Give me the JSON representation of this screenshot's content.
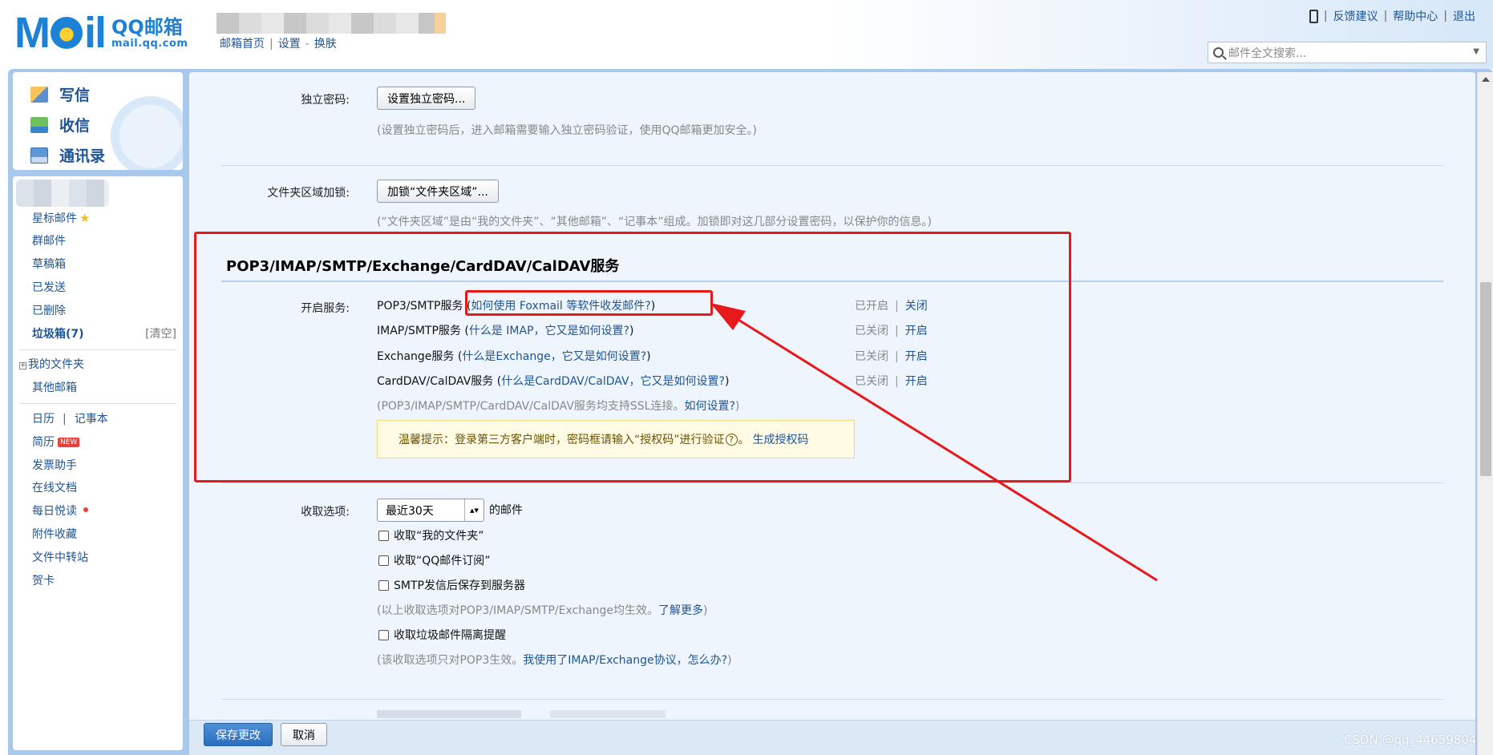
{
  "header": {
    "logo_text": "M  il",
    "brand_name": "QQ邮箱",
    "brand_domain": "mail.qq.com",
    "nav": [
      "邮箱首页",
      "设置",
      "换肤"
    ],
    "links": [
      "反馈建议",
      "帮助中心",
      "退出"
    ],
    "search_placeholder": "邮件全文搜索..."
  },
  "quick_actions": [
    "写信",
    "收信",
    "通讯录"
  ],
  "folders": {
    "starred": "星标邮件",
    "group": "群邮件",
    "drafts": "草稿箱",
    "sent": "已发送",
    "deleted": "已删除",
    "spam": "垃圾箱(7)",
    "spam_clear": "[清空]",
    "my_folders": "我的文件夹",
    "other_mailboxes": "其他邮箱",
    "calendar": "日历",
    "notebook": "记事本",
    "resume": "简历",
    "resume_badge": "NEW",
    "invoice": "发票助手",
    "docs": "在线文档",
    "daily": "每日悦读",
    "attachments": "附件收藏",
    "transfer": "文件中转站",
    "cards": "贺卡"
  },
  "settings": {
    "independent_password": {
      "label": "独立密码:",
      "button": "设置独立密码...",
      "hint": "(设置独立密码后，进入邮箱需要输入独立密码验证，使用QQ邮箱更加安全。)"
    },
    "folder_lock": {
      "label": "文件夹区域加锁:",
      "button": "加锁“文件夹区域”...",
      "hint": "(“文件夹区域”是由“我的文件夹”、“其他邮箱”、“记事本”组成。加锁即对这几部分设置密码，以保护你的信息。)"
    },
    "services": {
      "title": "POP3/IMAP/SMTP/Exchange/CardDAV/CalDAV服务",
      "label": "开启服务:",
      "rows": [
        {
          "name": "POP3/SMTP服务 (",
          "link": "如何使用 Foxmail 等软件收发邮件?",
          "close": ")",
          "status": "已开启",
          "action": "关闭"
        },
        {
          "name": "IMAP/SMTP服务 (",
          "link": "什么是 IMAP，它又是如何设置?",
          "close": ")",
          "status": "已关闭",
          "action": "开启"
        },
        {
          "name": "Exchange服务 (",
          "link": "什么是Exchange，它又是如何设置?",
          "close": ")",
          "status": "已关闭",
          "action": "开启"
        },
        {
          "name": "CardDAV/CalDAV服务 (",
          "link": "什么是CardDAV/CalDAV，它又是如何设置?",
          "close": ")",
          "status": "已关闭",
          "action": "开启"
        }
      ],
      "ssl_hint": "(POP3/IMAP/SMTP/CardDAV/CalDAV服务均支持SSL连接。",
      "ssl_link": "如何设置?",
      "ssl_close": ")",
      "tip_text_1": "温馨提示：登录第三方客户端时，密码框请输入“授权码”进行验证",
      "tip_text_2": "。",
      "tip_q": "?",
      "tip_link": "生成授权码"
    },
    "receive": {
      "label": "收取选项:",
      "select_value": "最近30天",
      "select_arrow": "▲▼",
      "suffix": "的邮件",
      "checks": [
        "收取“我的文件夹”",
        "收取“QQ邮件订阅”",
        "SMTP发信后保存到服务器"
      ],
      "hint1": "(以上收取选项对POP3/IMAP/SMTP/Exchange均生效。",
      "hint1_link": "了解更多",
      "hint1_close": ")",
      "check_spam": "收取垃圾邮件隔离提醒",
      "hint2": "(该收取选项只对POP3生效。",
      "hint2_link": "我使用了IMAP/Exchange协议，怎么办?",
      "hint2_close": ")"
    }
  },
  "footer": {
    "save": "保存更改",
    "cancel": "取消"
  },
  "watermark": "CSDN @qq_44659804",
  "colors": {
    "link": "#1e5494",
    "annotation": "#e8191b",
    "frame": "#a9c9ec",
    "panel": "#eef5fd"
  }
}
